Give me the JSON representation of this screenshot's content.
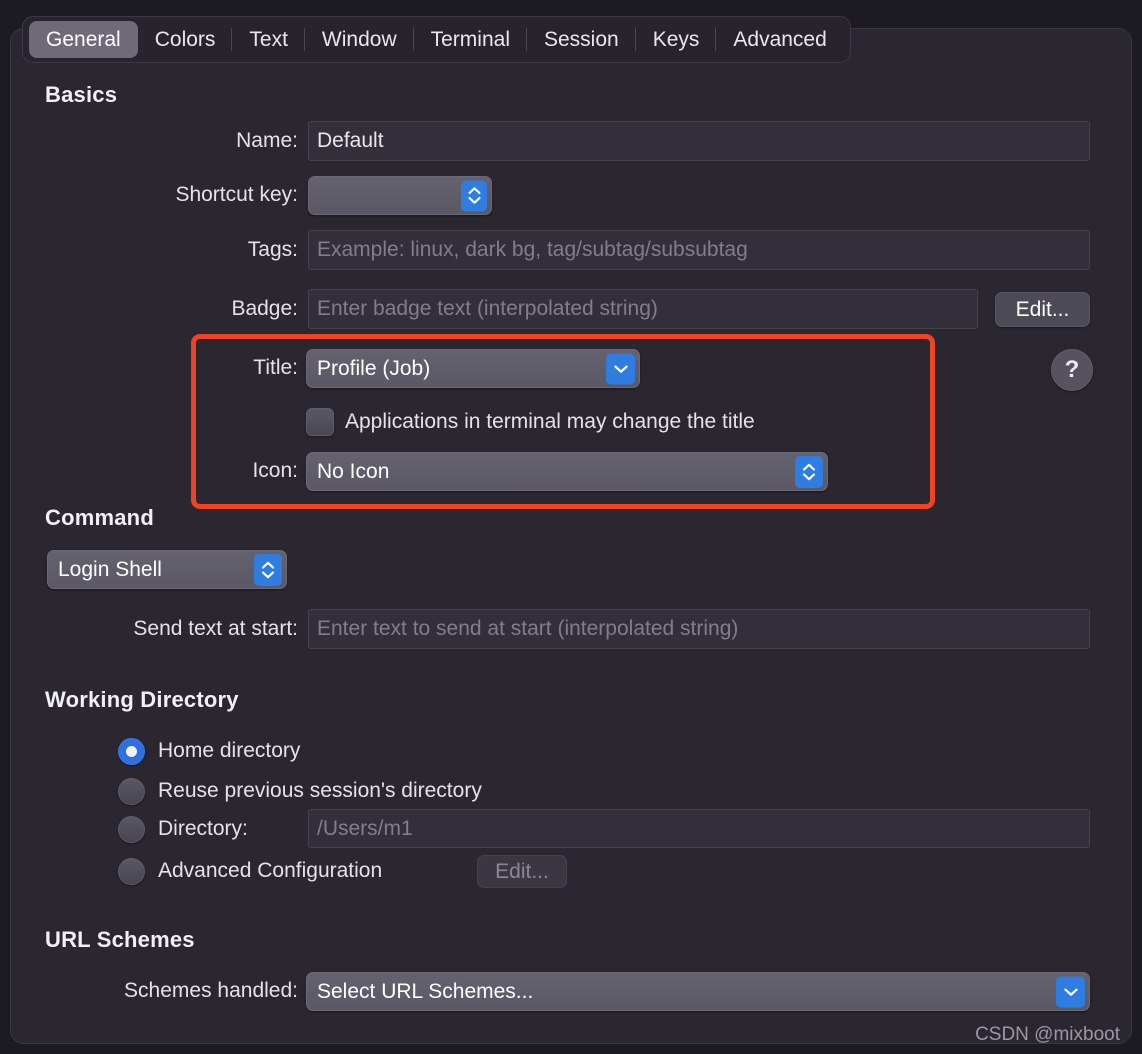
{
  "window": {
    "tabs": [
      {
        "label": "General",
        "active": true
      },
      {
        "label": "Colors",
        "active": false
      },
      {
        "label": "Text",
        "active": false
      },
      {
        "label": "Window",
        "active": false
      },
      {
        "label": "Terminal",
        "active": false
      },
      {
        "label": "Session",
        "active": false
      },
      {
        "label": "Keys",
        "active": false
      },
      {
        "label": "Advanced",
        "active": false
      }
    ]
  },
  "basics": {
    "heading": "Basics",
    "name": {
      "label": "Name:",
      "value": "Default"
    },
    "shortcut_key": {
      "label": "Shortcut key:",
      "value": ""
    },
    "tags": {
      "label": "Tags:",
      "value": "",
      "placeholder": "Example: linux, dark bg, tag/subtag/subsubtag"
    },
    "badge": {
      "label": "Badge:",
      "value": "",
      "placeholder": "Enter badge text (interpolated string)",
      "edit_label": "Edit..."
    },
    "title": {
      "label": "Title:",
      "value": "Profile (Job)"
    },
    "apps_may_change_title": {
      "label": "Applications in terminal may change the title",
      "checked": false
    },
    "icon": {
      "label": "Icon:",
      "value": "No Icon"
    },
    "help_label": "?"
  },
  "command": {
    "heading": "Command",
    "shell": {
      "value": "Login Shell"
    },
    "send_text_at_start": {
      "label": "Send text at start:",
      "value": "",
      "placeholder": "Enter text to send at start (interpolated string)"
    }
  },
  "working_directory": {
    "heading": "Working Directory",
    "options": [
      {
        "label": "Home directory",
        "selected": true
      },
      {
        "label": "Reuse previous session's directory",
        "selected": false
      },
      {
        "label": "Directory:",
        "selected": false
      },
      {
        "label": "Advanced Configuration",
        "selected": false
      }
    ],
    "directory": {
      "value": "",
      "placeholder": "/Users/m1"
    },
    "advanced_edit_label": "Edit..."
  },
  "url_schemes": {
    "heading": "URL Schemes",
    "schemes_handled": {
      "label": "Schemes handled:",
      "value": "Select URL Schemes..."
    }
  },
  "watermark": "CSDN @mixboot",
  "colors": {
    "accent_blue": "#2f7de1",
    "highlight_red": "#f04323",
    "panel_bg": "#2a2730",
    "window_bg": "#1d1b22"
  }
}
